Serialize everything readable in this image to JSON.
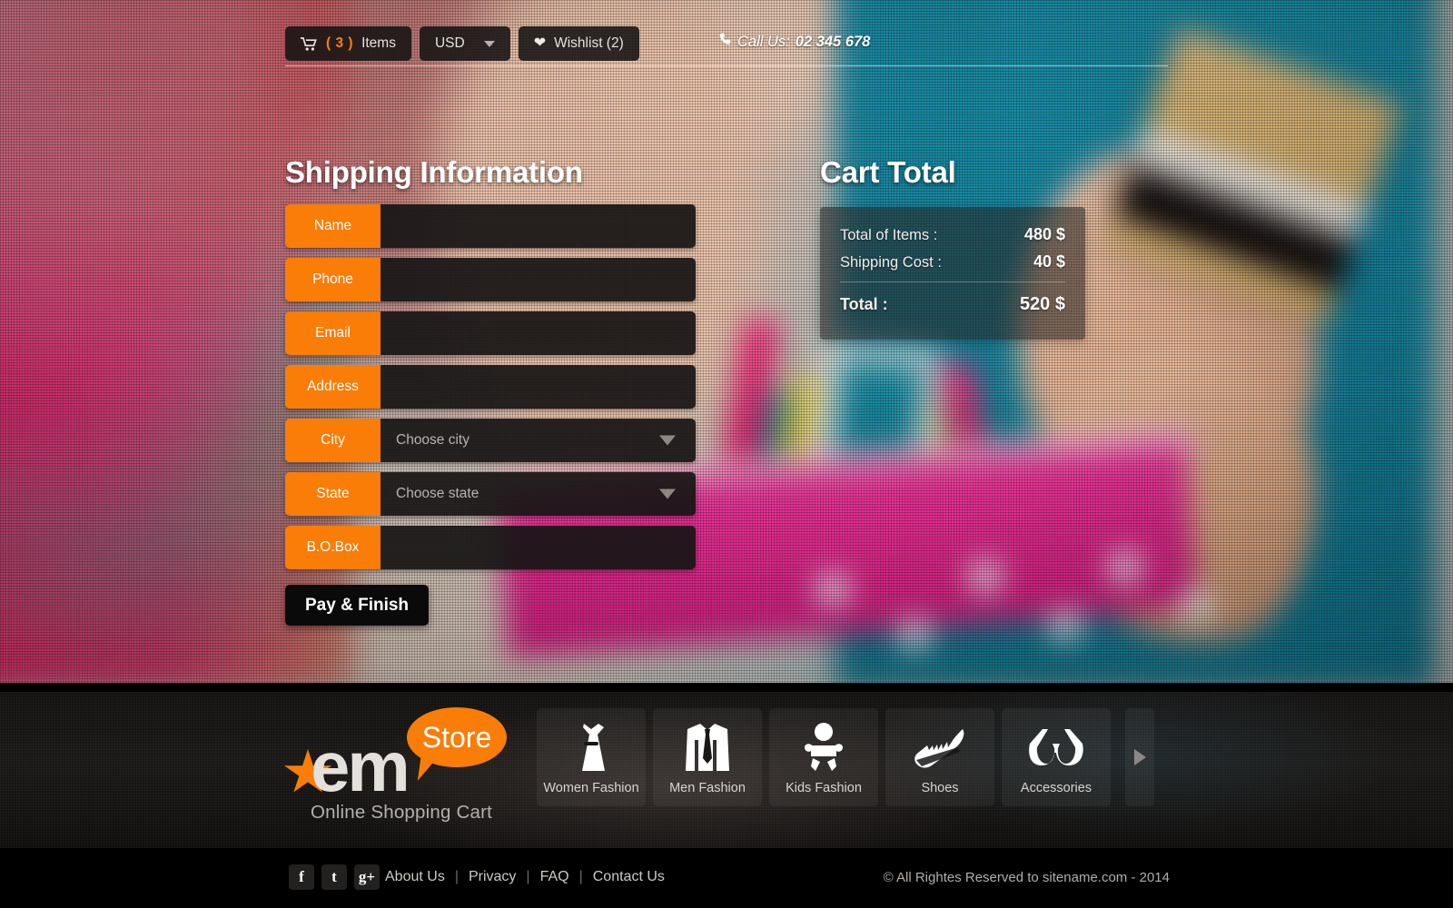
{
  "topbar": {
    "cart_icon": "shopping-cart-icon",
    "cart_count": "( 3 )",
    "cart_label": "Items",
    "currency": "USD",
    "currency_caret": "chevron-down-icon",
    "wishlist_icon": "heart-icon",
    "wishlist_label": "Wishlist (2)",
    "phone_icon": "phone-icon",
    "call_prefix": "Call Us:",
    "call_number": "02 345 678"
  },
  "shipping": {
    "title": "Shipping Information",
    "fields": [
      {
        "label": "Name",
        "type": "text",
        "value": "",
        "placeholder": ""
      },
      {
        "label": "Phone",
        "type": "text",
        "value": "",
        "placeholder": ""
      },
      {
        "label": "Email",
        "type": "text",
        "value": "",
        "placeholder": ""
      },
      {
        "label": "Address",
        "type": "text",
        "value": "",
        "placeholder": ""
      },
      {
        "label": "City",
        "type": "select",
        "value": "Choose city"
      },
      {
        "label": "State",
        "type": "select",
        "value": "Choose state"
      },
      {
        "label": "B.O.Box",
        "type": "text",
        "value": "",
        "placeholder": ""
      }
    ],
    "submit_label": "Pay & Finish"
  },
  "cart_total": {
    "title": "Cart Total",
    "rows": [
      {
        "label": "Total of Items :",
        "value": "480 $"
      },
      {
        "label": "Shipping Cost :",
        "value": "40 $"
      }
    ],
    "total_label": "Total :",
    "total_value": "520 $"
  },
  "footer": {
    "logo": {
      "star_icon": "star-icon",
      "word": "em",
      "bubble_word": "Store",
      "tagline": "Online Shopping Cart"
    },
    "categories": [
      {
        "icon": "dress-icon",
        "label": "Women Fashion"
      },
      {
        "icon": "suit-icon",
        "label": "Men Fashion"
      },
      {
        "icon": "baby-icon",
        "label": "Kids Fashion"
      },
      {
        "icon": "sneaker-icon",
        "label": "Shoes"
      },
      {
        "icon": "sunglasses-icon",
        "label": "Accessories"
      }
    ],
    "next_icon": "chevron-right-icon",
    "socials": [
      {
        "icon": "facebook-icon",
        "glyph": "f"
      },
      {
        "icon": "tumblr-icon",
        "glyph": "t"
      },
      {
        "icon": "googleplus-icon",
        "glyph": "g+"
      }
    ],
    "links": [
      "About Us",
      "Privacy",
      "FAQ",
      "Contact Us"
    ],
    "separator": "|",
    "copyright": "© All Rightes Reserved to sitename.com - 2014"
  },
  "colors": {
    "accent_orange": "#f97d07",
    "panel_dark": "#181615",
    "footer_black": "#000000"
  }
}
